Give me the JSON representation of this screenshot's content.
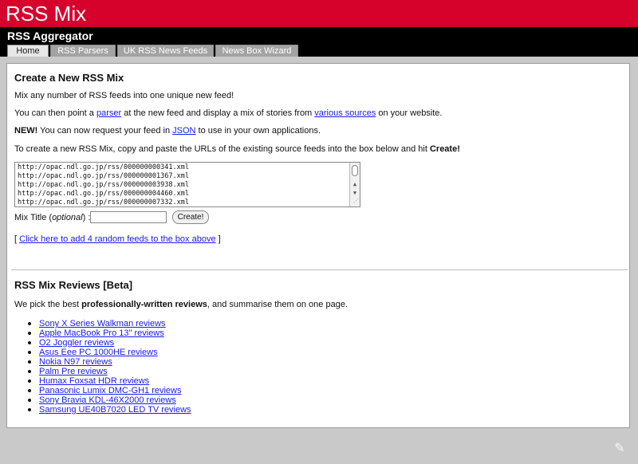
{
  "site": {
    "title": "RSS Mix",
    "subtitle": "RSS Aggregator"
  },
  "tabs": [
    {
      "label": "Home",
      "active": true
    },
    {
      "label": "RSS Parsers",
      "active": false
    },
    {
      "label": "UK RSS News Feeds",
      "active": false
    },
    {
      "label": "News Box Wizard",
      "active": false
    }
  ],
  "create": {
    "heading": "Create a New RSS Mix",
    "intro": "Mix any number of RSS feeds into one unique new feed!",
    "point_pre": "You can then point a ",
    "point_link1": "parser",
    "point_mid": " at the new feed and display a mix of stories from ",
    "point_link2": "various sources",
    "point_post": " on your website.",
    "new_label": "NEW!",
    "new_pre": " You can now request your feed in ",
    "new_link": "JSON",
    "new_post": " to use in your own applications.",
    "instr_pre": "To create a new RSS Mix, copy and paste the URLs of the existing source feeds into the box below and hit ",
    "instr_bold": "Create!",
    "feeds": [
      "http://opac.ndl.go.jp/rss/000000000341.xml",
      "http://opac.ndl.go.jp/rss/000000001367.xml",
      "http://opac.ndl.go.jp/rss/000000003938.xml",
      "http://opac.ndl.go.jp/rss/000000004460.xml",
      "http://opac.ndl.go.jp/rss/000000007332.xml"
    ],
    "mix_title_label": "Mix Title (",
    "mix_title_optional": "optional",
    "mix_title_suffix": ") :",
    "mix_title_value": "",
    "create_button": "Create!",
    "random_pre": "[ ",
    "random_link": "Click here to add 4 random feeds to the box above",
    "random_post": " ]"
  },
  "reviews": {
    "heading": "RSS Mix Reviews [Beta]",
    "intro_pre": "We pick the best ",
    "intro_bold": "professionally-written reviews",
    "intro_post": ", and summarise them on one page.",
    "items": [
      "Sony X Series Walkman reviews",
      "Apple MacBook Pro 13\" reviews",
      "O2 Joggler reviews",
      "Asus Eee PC 1000HE reviews",
      "Nokia N97 reviews",
      "Palm Pre reviews",
      "Humax Foxsat HDR reviews",
      "Panasonic Lumix DMC-GH1 reviews",
      "Sony Bravia KDL-46X2000 reviews",
      "Samsung UE40B7020 LED TV reviews"
    ]
  },
  "icons": {
    "corner": "edit-feather-icon",
    "scroll_up": "arrow-up-icon",
    "scroll_down": "arrow-down-icon"
  },
  "colors": {
    "brand_red": "#d6022c",
    "bar_black": "#000000",
    "link_blue": "#1a1aee",
    "page_bg": "#c9c9c9"
  }
}
